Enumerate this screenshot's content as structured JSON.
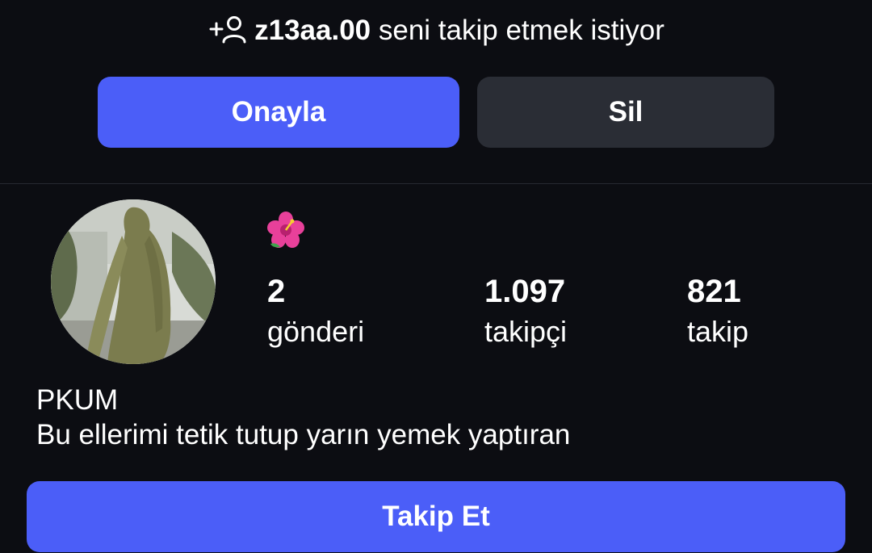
{
  "request": {
    "icon": "add-person-icon",
    "username": "z13aa.00",
    "message": " seni takip etmek istiyor",
    "confirm_label": "Onayla",
    "delete_label": "Sil"
  },
  "profile": {
    "bio_emoji": "🌺",
    "stats": {
      "posts_count": "2",
      "posts_label": "gönderi",
      "followers_count": "1.097",
      "followers_label": "takipçi",
      "following_count": "821",
      "following_label": "takip"
    },
    "fullname": "PKUM",
    "bio": "Bu ellerimi tetik tutup yarın yemek yaptıran",
    "follow_label": "Takip Et"
  },
  "colors": {
    "background": "#0c0d12",
    "primary_button": "#4b5ef8",
    "secondary_button": "#2a2d35"
  }
}
